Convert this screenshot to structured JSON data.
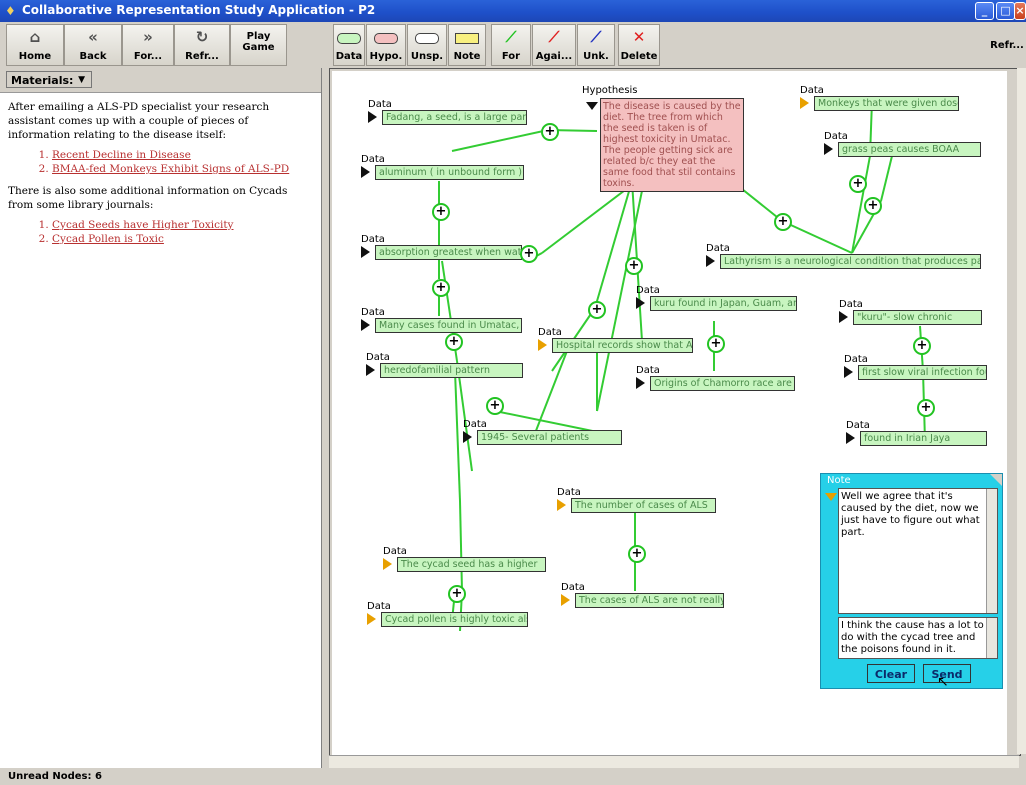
{
  "window": {
    "title": "Collaborative Representation Study Application - P2"
  },
  "nav_toolbar": [
    {
      "label": "Home",
      "icon": "home-icon"
    },
    {
      "label": "Back",
      "icon": "back-icon"
    },
    {
      "label": "For...",
      "icon": "forward-icon"
    },
    {
      "label": "Refr...",
      "icon": "refresh-icon"
    },
    {
      "label": "Play Game",
      "icon": ""
    }
  ],
  "graph_toolbar": [
    {
      "label": "Data",
      "icon": "data-shape-icon",
      "color": "#c8f5c0"
    },
    {
      "label": "Hypo.",
      "icon": "hypothesis-shape-icon",
      "color": "#f4c0c0"
    },
    {
      "label": "Unsp.",
      "icon": "unspecified-shape-icon",
      "color": "#ffffff"
    },
    {
      "label": "Note",
      "icon": "note-shape-icon",
      "color": "#f8f080"
    },
    {
      "label": "For",
      "icon": "link-for-icon",
      "color": "#22c322"
    },
    {
      "label": "Agai...",
      "icon": "link-against-icon",
      "color": "#e02020"
    },
    {
      "label": "Unk.",
      "icon": "link-unknown-icon",
      "color": "#2030c0"
    },
    {
      "label": "Delete",
      "icon": "delete-icon",
      "color": "#e02020"
    }
  ],
  "right_toolbar": {
    "label": "Refr..."
  },
  "materials": {
    "selector_label": "Materials:",
    "intro": "After emailing a ALS-PD specialist your research assistant comes up with a couple of pieces of information relating to the disease itself:",
    "links1": [
      "Recent Decline in Disease",
      "BMAA-fed Monkeys Exhibit Signs of ALS-PD"
    ],
    "para2": "There is also some additional information on Cycads from some library journals:",
    "links2": [
      "Cycad Seeds have Higher Toxicity",
      "Cycad Pollen is Toxic"
    ]
  },
  "nodes": [
    {
      "id": "n1",
      "type": "Data",
      "text": "Fadang, a seed, is a large part",
      "unread": false
    },
    {
      "id": "n2",
      "type": "Data",
      "text": "aluminum ( in unbound form ) in",
      "unread": false
    },
    {
      "id": "n3",
      "type": "Data",
      "text": "absorption greatest when water",
      "unread": false
    },
    {
      "id": "n4",
      "type": "Data",
      "text": "Many cases found in Umatac,",
      "unread": false
    },
    {
      "id": "n5",
      "type": "Data",
      "text": "heredofamilial pattern",
      "unread": false
    },
    {
      "id": "n6",
      "type": "Data",
      "text": "Hospital records show that ALS",
      "unread": true
    },
    {
      "id": "n7",
      "type": "Data",
      "text": "1945- Several patients",
      "unread": false
    },
    {
      "id": "n8",
      "type": "Data",
      "text": "kuru found in Japan, Guam, and",
      "unread": false
    },
    {
      "id": "n9",
      "type": "Data",
      "text": "Origins of Chamorro race are",
      "unread": false
    },
    {
      "id": "n10",
      "type": "Data",
      "text": "Monkeys that were given doses",
      "unread": true
    },
    {
      "id": "n11",
      "type": "Data",
      "text": "grass peas causes BOAA",
      "unread": false
    },
    {
      "id": "n12",
      "type": "Data",
      "text": "Lathyrism is a neurological condition that produces partial",
      "unread": false
    },
    {
      "id": "n13",
      "type": "Data",
      "text": "\"kuru\"- slow chronic",
      "unread": false
    },
    {
      "id": "n14",
      "type": "Data",
      "text": "first slow viral infection found in",
      "unread": false
    },
    {
      "id": "n15",
      "type": "Data",
      "text": "found in Irian Jaya",
      "unread": false
    },
    {
      "id": "n16",
      "type": "Data",
      "text": "The number of cases of ALS",
      "unread": true
    },
    {
      "id": "n17",
      "type": "Data",
      "text": "The cases of ALS are not really",
      "unread": true
    },
    {
      "id": "n18",
      "type": "Data",
      "text": "The cycad seed has a higher",
      "unread": true
    },
    {
      "id": "n19",
      "type": "Data",
      "text": "Cycad pollen is highly toxic also.",
      "unread": true
    }
  ],
  "hypothesis": {
    "type": "Hypothesis",
    "text": "The disease is caused by the diet.  The tree from which the seed is taken is of highest toxicity in Umatac.  The people getting sick are related b/c they eat the same food that stil contains toxins."
  },
  "note": {
    "title": "Note",
    "message": "Well we agree that it's caused by the diet, now we just have to figure out what part.",
    "draft": "I think the cause has a lot to do with the cycad tree and the poisons found in it.",
    "clear_label": "Clear",
    "send_label": "Send"
  },
  "status": {
    "text": "Unread Nodes: 6"
  }
}
